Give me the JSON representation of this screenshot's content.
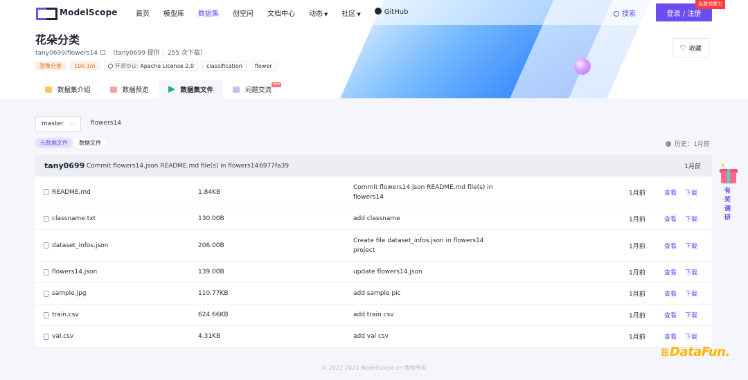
{
  "nav": {
    "logo": "ModelScope",
    "links": [
      {
        "label": "首页",
        "active": false,
        "caret": false
      },
      {
        "label": "模型库",
        "active": false,
        "caret": false
      },
      {
        "label": "数据集",
        "active": true,
        "caret": false
      },
      {
        "label": "创空间",
        "active": false,
        "caret": false
      },
      {
        "label": "文档中心",
        "active": false,
        "caret": false
      },
      {
        "label": "动态",
        "active": false,
        "caret": true
      },
      {
        "label": "社区",
        "active": false,
        "caret": true
      }
    ],
    "github": "GitHub",
    "search": "搜索",
    "login": "登录 / 注册",
    "promo": "免费领算力"
  },
  "dataset": {
    "title": "花朵分类",
    "path": "tany0699/flowers14",
    "provider": "（tany0699 提供",
    "downloads": "255 次下载）",
    "tags": {
      "task": "图像分类",
      "size": "10k-1m",
      "license_label": "开源协议:",
      "license": "Apache License 2.0",
      "t1": "classification",
      "t2": "flower"
    },
    "favorite": "收藏"
  },
  "tabs": [
    {
      "label": "数据集介绍",
      "icon": "cube-icon"
    },
    {
      "label": "数据预览",
      "icon": "preview-icon"
    },
    {
      "label": "数据集文件",
      "icon": "files-icon"
    },
    {
      "label": "问题交流",
      "icon": "chat-icon"
    }
  ],
  "tab_new_badge": "new",
  "files_view": {
    "branch": "master",
    "path": "flowers14",
    "toggle_meta": "元数据文件",
    "toggle_files": "数据文件",
    "history": "历史：1月前"
  },
  "commit": {
    "user": "tany0699",
    "message": "Commit flowers14.json README.md file(s) in flowers14",
    "hash": "6977fa39",
    "time": "1月前"
  },
  "files": [
    {
      "name": "README.md",
      "size": "1.84KB",
      "msg": "Commit flowers14.json README.md file(s) in flowers14",
      "time": "1月前"
    },
    {
      "name": "classname.txt",
      "size": "130.00B",
      "msg": "add classname",
      "time": "1月前"
    },
    {
      "name": "dataset_infos.json",
      "size": "206.00B",
      "msg": "Create file dataset_infos.json in flowers14 project",
      "time": "1月前"
    },
    {
      "name": "flowers14.json",
      "size": "139.00B",
      "msg": "update flowers14.json",
      "time": "1月前"
    },
    {
      "name": "sample.jpg",
      "size": "110.77KB",
      "msg": "add sample pic",
      "time": "1月前"
    },
    {
      "name": "train.csv",
      "size": "624.66KB",
      "msg": "add train csv",
      "time": "1月前"
    },
    {
      "name": "val.csv",
      "size": "4.31KB",
      "msg": "add val csv",
      "time": "1月前"
    }
  ],
  "row_actions": {
    "view": "查看",
    "download": "下载"
  },
  "footer": "© 2022-2023 ModelScope.cn 版权所有",
  "survey": "有奖调研",
  "watermark": "DataFun."
}
